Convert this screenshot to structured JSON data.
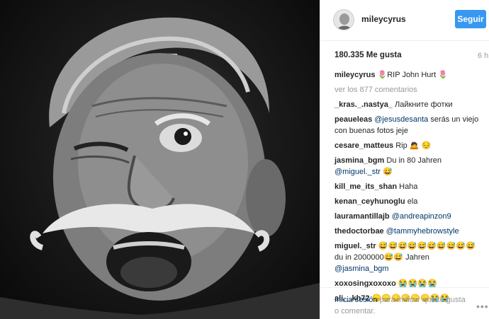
{
  "header": {
    "username": "mileycyrus",
    "follow_label": "Seguir"
  },
  "post": {
    "likes": "180.335 Me gusta",
    "time": "6 h"
  },
  "caption": {
    "user": "mileycyrus",
    "text": "🌷RIP John Hurt 🌷"
  },
  "view_all": "ver los 877 comentarios",
  "comments": [
    {
      "user": "_kras._.nastya_",
      "text": "Лайкните фотки"
    },
    {
      "user": "peaueleas",
      "mention": "@jesusdesanta",
      "text": " serás un viejo con buenas fotos jeje"
    },
    {
      "user": "cesare_matteus",
      "text": "Rip 🙇 😔"
    },
    {
      "user": "jasmina_bgm",
      "text": "Du in 80 Jahren ",
      "mention2": "@miguel._str",
      "tail": " 😅"
    },
    {
      "user": "kill_me_its_shan",
      "text": "Haha"
    },
    {
      "user": "kenan_ceyhunoglu",
      "text": "ela"
    },
    {
      "user": "lauramantillajb",
      "mention": "@andreapinzon9"
    },
    {
      "user": "thedoctorbae",
      "mention": "@tammyhebrowstyle"
    },
    {
      "user": "miguel._str",
      "text": "😅😅😅😅😅😅😅😅😅😅 du in 2000000😅😅 Jahren ",
      "mention2": "@jasmina_bgm"
    },
    {
      "user": "xoxosingxoxoxo",
      "text": "😭😭😭😭"
    },
    {
      "user": "ali._.kh72",
      "text": "😞😞😞😞😞😞😭😭"
    }
  ],
  "footer": {
    "login_link": "Inicia sesión",
    "login_text": " para indicar que te gusta o comentar.",
    "more": "•••"
  },
  "icons": {
    "more": "ellipsis-icon"
  }
}
